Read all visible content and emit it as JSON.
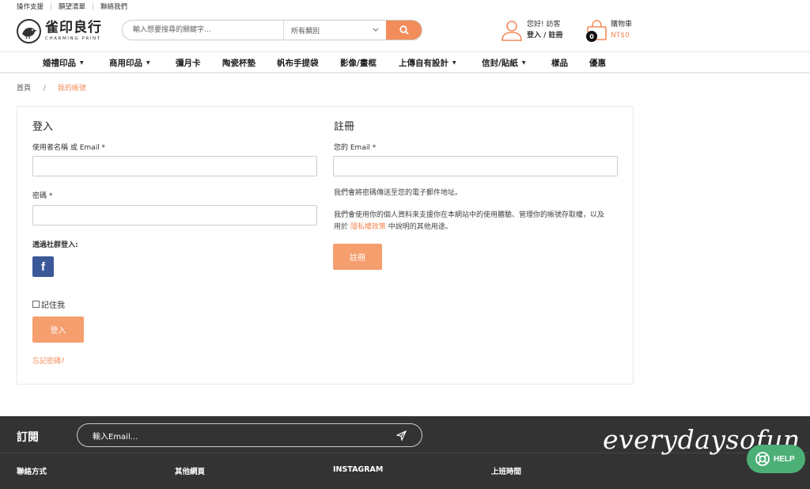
{
  "topbar": {
    "links": [
      "操作支援",
      "願望清單",
      "聯絡我們"
    ]
  },
  "logo": {
    "main": "雀印良行",
    "sub": "CHARMING PRINT"
  },
  "search": {
    "placeholder": "輸入想要搜尋的關鍵字...",
    "category": "所有類別"
  },
  "account": {
    "greeting": "您好! 訪客",
    "action": "登入 / 註冊"
  },
  "cart": {
    "label": "購物車",
    "price": "NT$0",
    "count": "0"
  },
  "nav": [
    {
      "label": "婚禮印品",
      "caret": "▼"
    },
    {
      "label": "商用印品",
      "caret": "▼"
    },
    {
      "label": "彌月卡",
      "caret": ""
    },
    {
      "label": "陶瓷杯墊",
      "caret": ""
    },
    {
      "label": "帆布手提袋",
      "caret": ""
    },
    {
      "label": "影像/畫框",
      "caret": ""
    },
    {
      "label": "上傳自有設計",
      "caret": "▼"
    },
    {
      "label": "信封/貼紙",
      "caret": "▼"
    },
    {
      "label": "樣品",
      "caret": ""
    },
    {
      "label": "優惠",
      "caret": ""
    }
  ],
  "breadcrumb": {
    "home": "首頁",
    "sep": "/",
    "current": "我的帳號"
  },
  "login": {
    "title": "登入",
    "username_label": "使用者名稱 或 Email *",
    "password_label": "密碼 *",
    "social_label": "透過社群登入:",
    "facebook": "f",
    "remember": "記住我",
    "submit": "登入",
    "forgot": "忘記密碼?"
  },
  "register": {
    "title": "註冊",
    "email_label": "您的 Email *",
    "note": "我們會將密碼傳送至您的電子郵件地址。",
    "privacy_line1": "我們會使用你的個人資料來支援你在本網站中的使用體驗、管理你的帳號存取權，以及",
    "privacy_pre": "用於",
    "privacy_link": "隱私權政策",
    "privacy_post": "中說明的其他用途。",
    "submit": "註冊"
  },
  "footer": {
    "subscribe_title": "訂閱",
    "subscribe_placeholder": "輸入Email...",
    "columns": [
      "聯絡方式",
      "其他網頁",
      "INSTAGRAM",
      "上班時間"
    ],
    "watermark": "everydaysofun"
  },
  "help": {
    "label": "HELP"
  },
  "colors": {
    "accent": "#f28c5a",
    "facebook": "#3b5998",
    "footer": "#333333",
    "help": "#4caf76"
  }
}
